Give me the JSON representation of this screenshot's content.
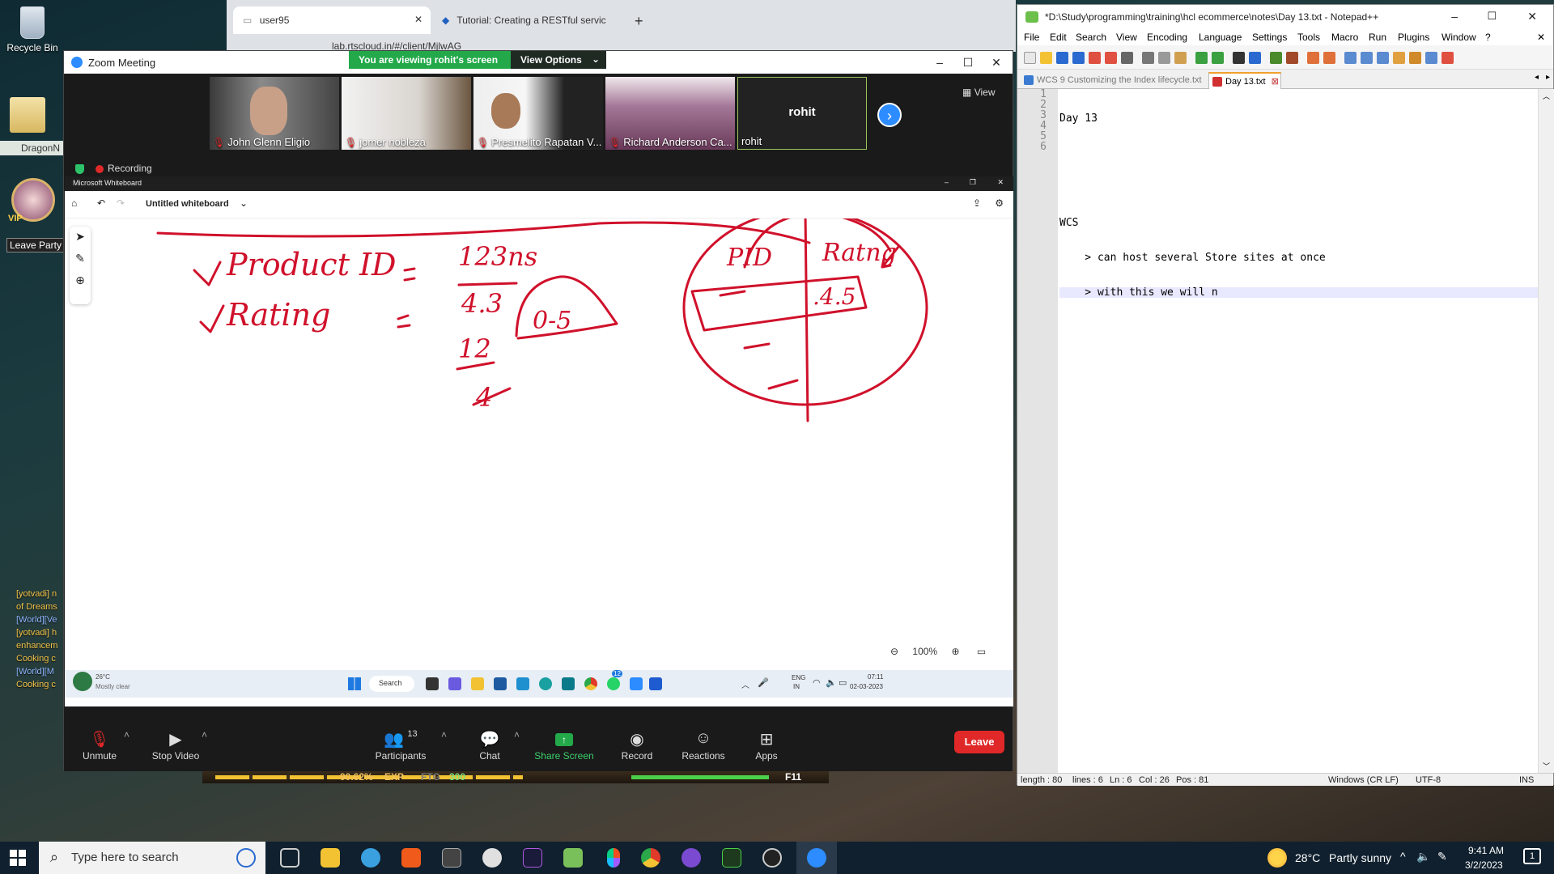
{
  "desktop": {
    "icons": [
      {
        "label": "Recycle Bin",
        "icon": "recycle-bin-icon"
      },
      {
        "label": "DragonN",
        "icon": "game-shortcut-icon"
      }
    ],
    "game": {
      "leave_party": "Leave Party",
      "vip": "VIP",
      "chat_lines": [
        "[yotvadi] n",
        "of Dreams",
        "[World][Ve",
        "[yotvadi] h",
        "enhancem",
        "Cooking c",
        "[World][M",
        "Cooking c"
      ],
      "exp_percent": "90.62%",
      "exp_label": "EXP",
      "ftg_label": "FTG",
      "ftg_value": "300",
      "hotkey": "F11"
    }
  },
  "browser": {
    "tabs": [
      {
        "title": "user95"
      },
      {
        "title": "Tutorial: Creating a RESTful servic"
      }
    ],
    "url": "lab.rtscloud.in/#/client/MjlwAGMAbXlzcWw="
  },
  "zoom": {
    "window_title": "Zoom Meeting",
    "banner_text": "You are viewing rohit's screen",
    "view_options": "View Options",
    "view_button": "View",
    "recording_label": "Recording",
    "participants_video": [
      {
        "name": "John Glenn Eligio",
        "muted": true
      },
      {
        "name": "jomer nobleza",
        "muted": true
      },
      {
        "name": "Presmelito Rapatan V...",
        "muted": true
      },
      {
        "name": "Richard Anderson Ca...",
        "muted": true
      },
      {
        "name": "rohit",
        "muted": false,
        "center_label": "rohit"
      }
    ],
    "controls": {
      "unmute": "Unmute",
      "stop_video": "Stop Video",
      "participants": "Participants",
      "participants_count": "13",
      "chat": "Chat",
      "share_screen": "Share Screen",
      "record": "Record",
      "reactions": "Reactions",
      "apps": "Apps",
      "leave": "Leave"
    }
  },
  "shared_screen": {
    "app_title": "Microsoft Whiteboard",
    "board_name": "Untitled whiteboard",
    "zoom_level": "100%",
    "inner_taskbar": {
      "weather_temp": "26°C",
      "weather_desc": "Mostly clear",
      "search": "Search",
      "language": "ENG",
      "region": "IN",
      "time": "07:11",
      "date": "02-03-2023",
      "badge": "12"
    }
  },
  "notepad": {
    "title": "*D:\\Study\\programming\\training\\hcl ecommerce\\notes\\Day 13.txt - Notepad++",
    "menu": [
      "File",
      "Edit",
      "Search",
      "View",
      "Encoding",
      "Language",
      "Settings",
      "Tools",
      "Macro",
      "Run",
      "Plugins",
      "Window",
      "?"
    ],
    "tabs": [
      {
        "title": "WCS 9 Customizing the Index lifecycle.txt",
        "active": false
      },
      {
        "title": "Day 13.txt",
        "active": true
      }
    ],
    "lines": [
      "Day 13",
      "",
      "",
      "WCS",
      "    > can host several Store sites at once",
      "    > with this we will n"
    ],
    "current_line": 6,
    "status": {
      "length": "length : 80",
      "lines": "lines : 6",
      "ln": "Ln : 6",
      "col": "Col : 26",
      "pos": "Pos : 81",
      "eol": "Windows (CR LF)",
      "encoding": "UTF-8",
      "mode": "INS"
    }
  },
  "taskbar": {
    "search_placeholder": "Type here to search",
    "weather_temp": "28°C",
    "weather_desc": "Partly sunny",
    "time": "9:41 AM",
    "date": "3/2/2023",
    "notification_count": "1",
    "colors": {
      "bg": "#10202e",
      "zoom_accent": "#2d8cff",
      "leave_red": "#e02828",
      "share_green": "#23a94a",
      "ink_red": "#d0112b"
    }
  }
}
